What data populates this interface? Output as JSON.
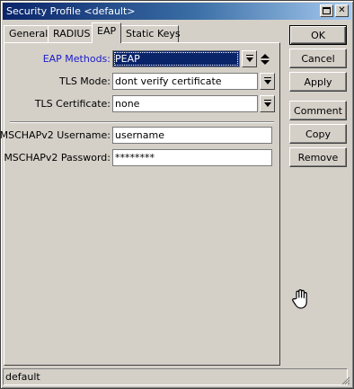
{
  "window": {
    "title": "Security Profile <default>",
    "max_glyph": "☐",
    "close_glyph": "✕"
  },
  "tabs": [
    {
      "label": "General",
      "active": false
    },
    {
      "label": "RADIUS",
      "active": false
    },
    {
      "label": "EAP",
      "active": true
    },
    {
      "label": "Static Keys",
      "active": false
    }
  ],
  "form": {
    "eap_methods": {
      "label": "EAP Methods:",
      "value": "PEAP"
    },
    "tls_mode": {
      "label": "TLS Mode:",
      "value": "dont verify certificate"
    },
    "tls_certificate": {
      "label": "TLS Certificate:",
      "value": "none"
    },
    "mschap_username": {
      "label": "MSCHAPv2 Username:",
      "value": "username"
    },
    "mschap_password": {
      "label": "MSCHAPv2 Password:",
      "value": "********"
    }
  },
  "buttons": {
    "ok": "OK",
    "cancel": "Cancel",
    "apply": "Apply",
    "comment": "Comment",
    "copy": "Copy",
    "remove": "Remove"
  },
  "status": {
    "text": "default"
  },
  "icons": {
    "dropdown": "dropdown-arrow-icon",
    "updown": "up-down-arrows-icon",
    "cursor": "hand-cursor-icon"
  },
  "colors": {
    "titlebar_start": "#0a246a",
    "titlebar_end": "#a6caf0",
    "face": "#d4d0c8",
    "label_blue": "#1a1acc",
    "selection": "#0a246a"
  }
}
